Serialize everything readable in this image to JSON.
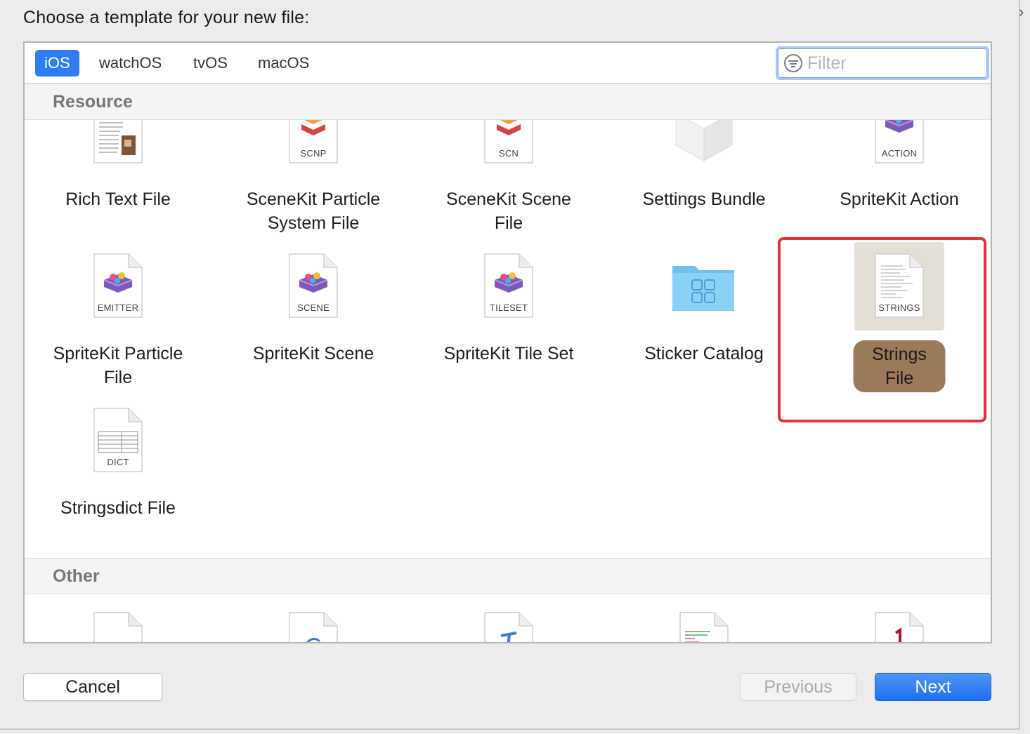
{
  "dialog": {
    "prompt": "Choose a template for your new file:"
  },
  "tabs": [
    {
      "label": "iOS",
      "active": true
    },
    {
      "label": "watchOS",
      "active": false
    },
    {
      "label": "tvOS",
      "active": false
    },
    {
      "label": "macOS",
      "active": false
    }
  ],
  "filter": {
    "placeholder": "Filter",
    "value": ""
  },
  "sections": {
    "resource": "Resource",
    "other": "Other"
  },
  "templates": [
    {
      "name": "Rich Text File",
      "line1": "Rich Text File",
      "line2": "",
      "icon": "rich-text-doc-icon",
      "tag": ""
    },
    {
      "name": "SceneKit Particle System File",
      "line1": "SceneKit Particle",
      "line2": "System File",
      "icon": "scenekit-doc-icon",
      "tag": "SCNP"
    },
    {
      "name": "SceneKit Scene File",
      "line1": "SceneKit Scene",
      "line2": "File",
      "icon": "scenekit-doc-icon",
      "tag": "SCN"
    },
    {
      "name": "Settings Bundle",
      "line1": "Settings Bundle",
      "line2": "",
      "icon": "settings-bundle-box-icon",
      "tag": ""
    },
    {
      "name": "SpriteKit Action",
      "line1": "SpriteKit Action",
      "line2": "",
      "icon": "spritekit-doc-icon",
      "tag": "ACTION"
    },
    {
      "name": "SpriteKit Particle File",
      "line1": "SpriteKit Particle",
      "line2": "File",
      "icon": "spritekit-doc-icon",
      "tag": "EMITTER"
    },
    {
      "name": "SpriteKit Scene",
      "line1": "SpriteKit Scene",
      "line2": "",
      "icon": "spritekit-doc-icon",
      "tag": "SCENE"
    },
    {
      "name": "SpriteKit Tile Set",
      "line1": "SpriteKit Tile Set",
      "line2": "",
      "icon": "spritekit-doc-icon",
      "tag": "TILESET"
    },
    {
      "name": "Sticker Catalog",
      "line1": "Sticker Catalog",
      "line2": "",
      "icon": "sticker-folder-icon",
      "tag": ""
    },
    {
      "name": "Strings File",
      "line1": "Strings File",
      "line2": "",
      "icon": "strings-doc-icon",
      "tag": "STRINGS",
      "selected": true
    },
    {
      "name": "Stringsdict File",
      "line1": "Stringsdict File",
      "line2": "",
      "icon": "table-doc-icon",
      "tag": "DICT"
    }
  ],
  "buttons": {
    "cancel": "Cancel",
    "previous": "Previous",
    "next": "Next"
  },
  "colors": {
    "accent": "#2f7ef1",
    "selection_label": "#9a7a59",
    "selection_bg": "#e3ded6",
    "highlight_box": "#e2313a"
  }
}
